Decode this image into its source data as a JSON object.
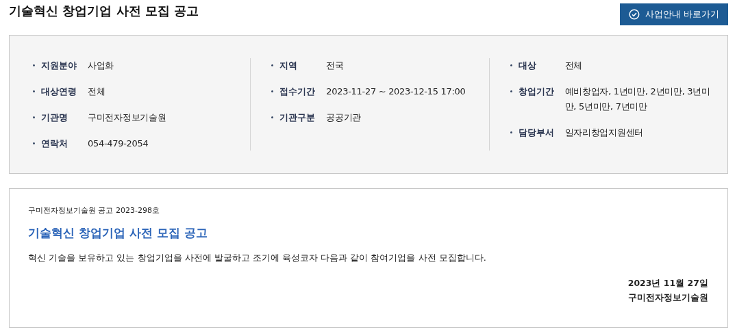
{
  "title": "기술혁신 창업기업 사전 모집 공고",
  "shortcut_button": {
    "label": "사업안내 바로가기"
  },
  "info_columns": [
    [
      {
        "label": "지원분야",
        "value": "사업화"
      },
      {
        "label": "대상연령",
        "value": "전체"
      },
      {
        "label": "기관명",
        "value": "구미전자정보기술원"
      },
      {
        "label": "연락처",
        "value": "054-479-2054"
      }
    ],
    [
      {
        "label": "지역",
        "value": "전국"
      },
      {
        "label": "접수기간",
        "value": "2023-11-27 ~ 2023-12-15 17:00"
      },
      {
        "label": "기관구분",
        "value": "공공기관"
      }
    ],
    [
      {
        "label": "대상",
        "value": "전체"
      },
      {
        "label": "창업기간",
        "value": "예비창업자, 1년미만, 2년미만, 3년미만, 5년미만, 7년미만"
      },
      {
        "label": "담당부서",
        "value": "일자리창업지원센터"
      }
    ]
  ],
  "notice": {
    "number": "구미전자정보기술원 공고 2023-298호",
    "heading": "기술혁신 창업기업 사전 모집 공고",
    "body": "혁신 기술을 보유하고 있는 창업기업을 사전에 발굴하고 조기에 육성코자 다음과 같이 참여기업을 사전 모집합니다.",
    "date": "2023년 11월 27일",
    "issuer": "구미전자정보기술원"
  }
}
